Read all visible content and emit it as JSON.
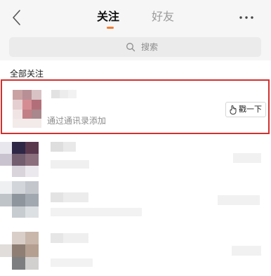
{
  "header": {
    "back_icon": "chevron-left-icon",
    "tabs": [
      {
        "label": "关注",
        "active": true
      },
      {
        "label": "好友",
        "active": false
      }
    ],
    "more_icon": "ellipsis-icon",
    "accent_color": "#f27b2d"
  },
  "search": {
    "icon": "search-icon",
    "placeholder": "搜索"
  },
  "section": {
    "title": "全部关注"
  },
  "highlighted_contact": {
    "subtitle": "通过通讯录添加",
    "action_label": "戳一下",
    "action_icon": "poke-hand-icon",
    "highlight_color": "#d2312f"
  }
}
